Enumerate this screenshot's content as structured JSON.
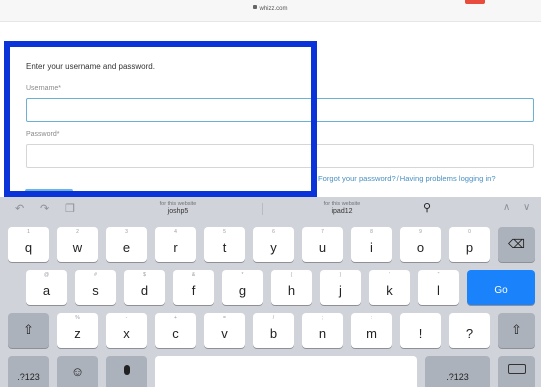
{
  "browser": {
    "url": "whizz.com"
  },
  "form": {
    "prompt": "Enter your username and password.",
    "username_label": "Username*",
    "username_value": "",
    "password_label": "Password*",
    "password_value": "",
    "forgot_link": "Forgot your password?",
    "separator": "/",
    "problems_link": "Having problems logging in?"
  },
  "suggestions": {
    "left": {
      "sub": "for this website",
      "main": "joshp5"
    },
    "right": {
      "sub": "for this website",
      "main": "ipad12"
    }
  },
  "keyboard": {
    "row1": [
      {
        "hint": "1",
        "ch": "q"
      },
      {
        "hint": "2",
        "ch": "w"
      },
      {
        "hint": "3",
        "ch": "e"
      },
      {
        "hint": "4",
        "ch": "r"
      },
      {
        "hint": "5",
        "ch": "t"
      },
      {
        "hint": "6",
        "ch": "y"
      },
      {
        "hint": "7",
        "ch": "u"
      },
      {
        "hint": "8",
        "ch": "i"
      },
      {
        "hint": "9",
        "ch": "o"
      },
      {
        "hint": "0",
        "ch": "p"
      }
    ],
    "row2": [
      {
        "hint": "@",
        "ch": "a"
      },
      {
        "hint": "#",
        "ch": "s"
      },
      {
        "hint": "$",
        "ch": "d"
      },
      {
        "hint": "&",
        "ch": "f"
      },
      {
        "hint": "*",
        "ch": "g"
      },
      {
        "hint": "(",
        "ch": "h"
      },
      {
        "hint": ")",
        "ch": "j"
      },
      {
        "hint": "'",
        "ch": "k"
      },
      {
        "hint": "\"",
        "ch": "l"
      }
    ],
    "row3": [
      {
        "hint": "%",
        "ch": "z"
      },
      {
        "hint": "-",
        "ch": "x"
      },
      {
        "hint": "+",
        "ch": "c"
      },
      {
        "hint": "=",
        "ch": "v"
      },
      {
        "hint": "/",
        "ch": "b"
      },
      {
        "hint": ";",
        "ch": "n"
      },
      {
        "hint": ":",
        "ch": "m"
      },
      {
        "hint": "",
        "ch": "!"
      },
      {
        "hint": "",
        "ch": "?"
      }
    ],
    "go_label": "Go",
    "numbers_label": ".?123"
  }
}
